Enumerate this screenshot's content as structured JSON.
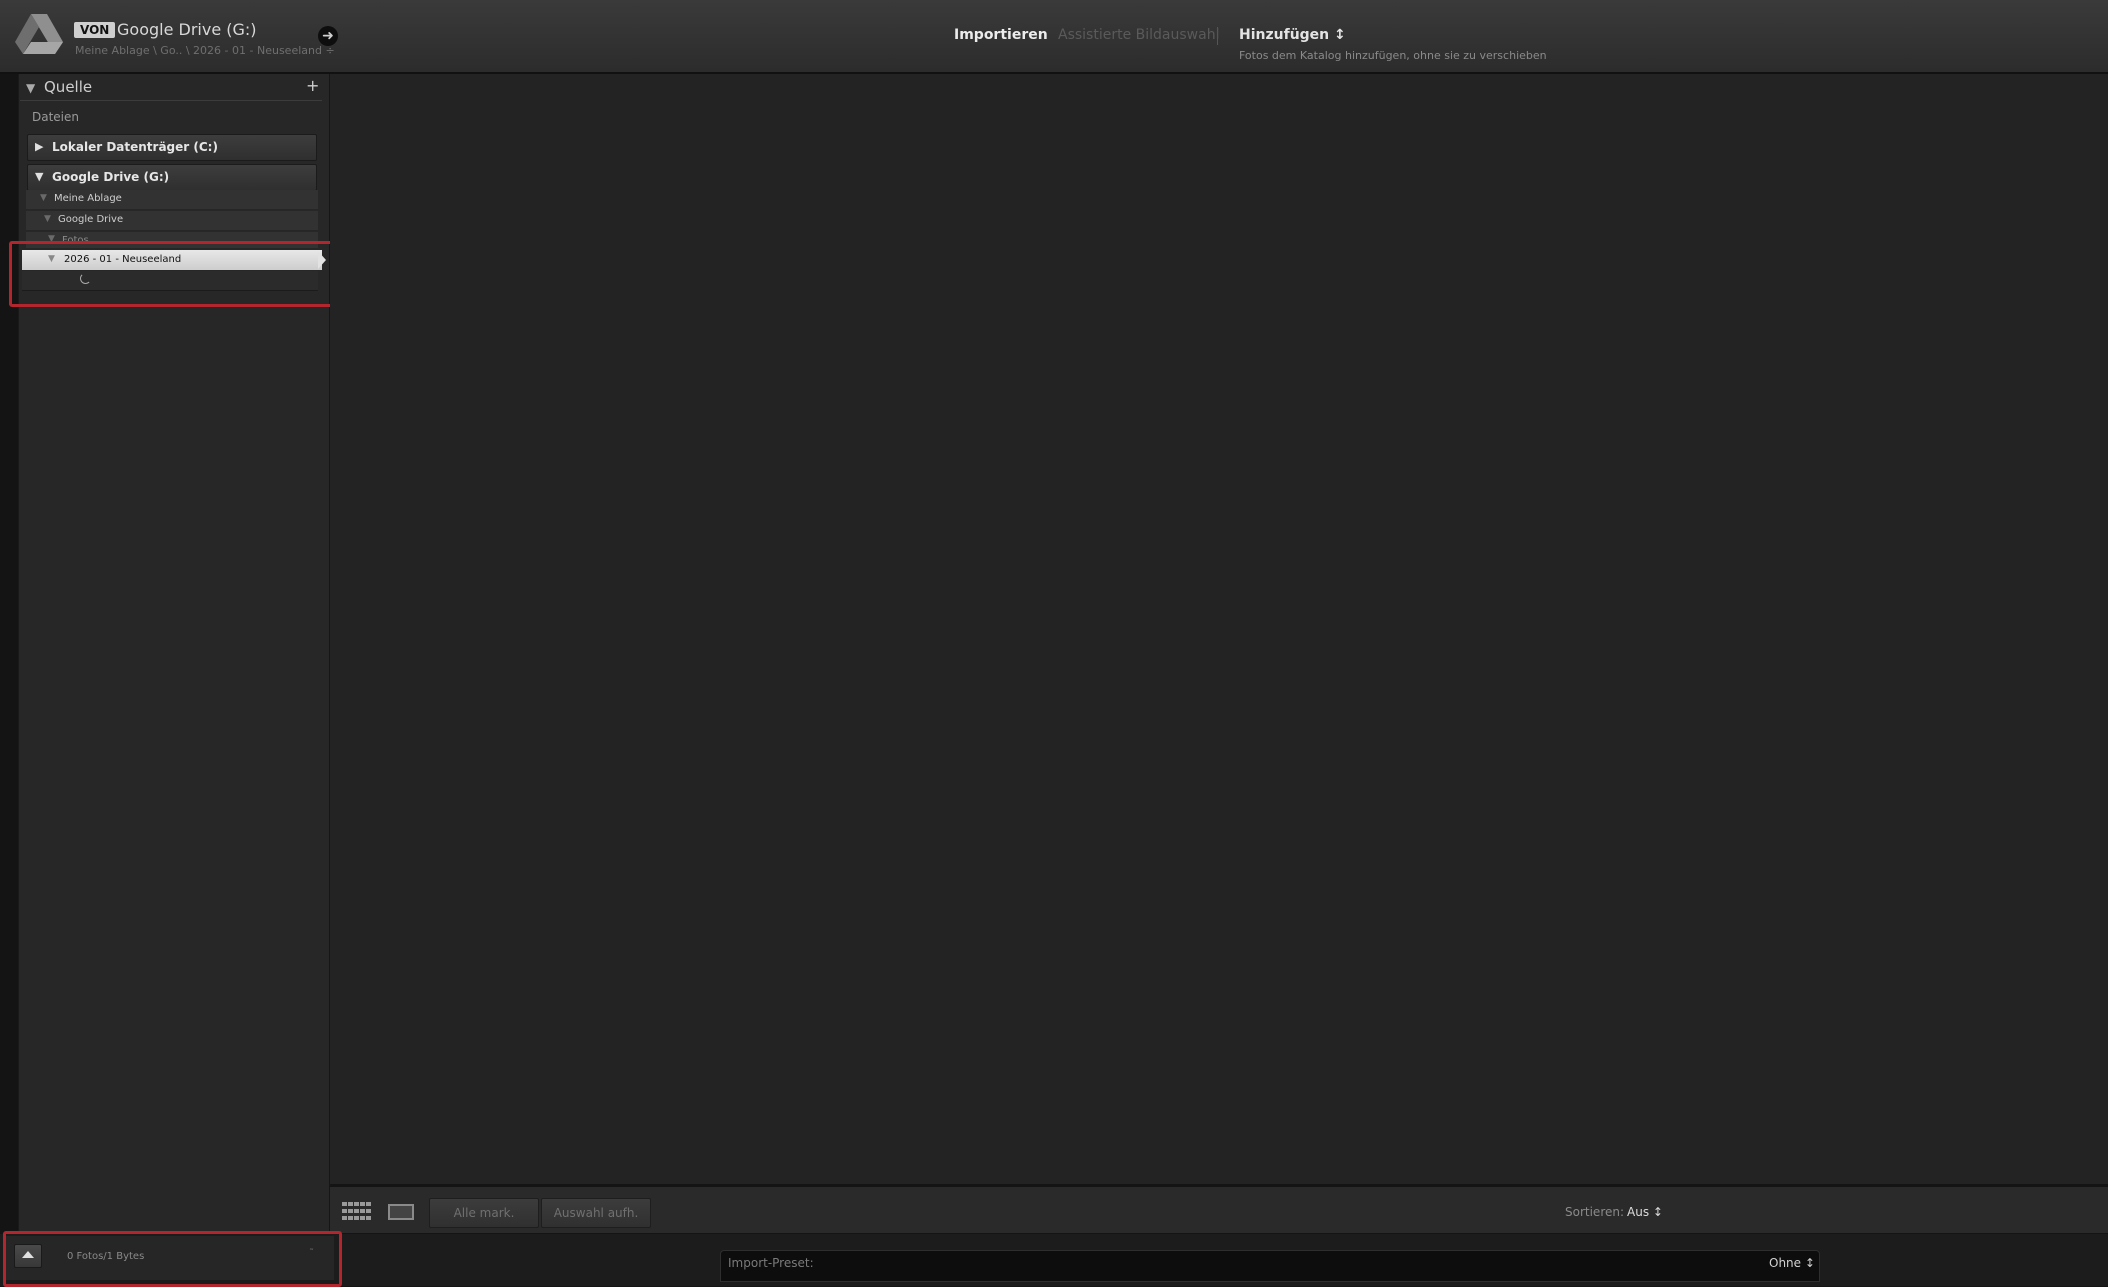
{
  "header": {
    "badge": "VON",
    "source_title": "Google Drive (G:)",
    "source_path": "Meine Ablage \\ Go.. \\ 2026 - 01 - Neuseeland ÷",
    "nav_icon": "arrow-right-icon",
    "modes": {
      "import": "Importieren",
      "assisted": "Assistierte Bildauswahl",
      "add": "Hinzufügen ↕",
      "add_subtitle": "Fotos dem Katalog hinzufügen, ohne sie zu verschieben"
    }
  },
  "source_panel": {
    "title": "Quelle",
    "add_icon": "+",
    "files_label": "Dateien",
    "volumes": [
      {
        "label": "Lokaler Datenträger (C:)",
        "expanded": false
      },
      {
        "label": "Google Drive (G:)",
        "expanded": true
      }
    ],
    "folders": [
      {
        "label": "Meine Ablage"
      },
      {
        "label": "Google Drive"
      },
      {
        "label": "Fotos"
      },
      {
        "label": "2026 - 01 - Neuseeland",
        "selected": true
      }
    ]
  },
  "toolbar": {
    "select_all": "Alle mark.",
    "deselect": "Auswahl aufh.",
    "sort_label": "Sortieren:",
    "sort_value": "Aus ↕"
  },
  "status": {
    "photo_count": "0 Fotos/1 Bytes",
    "status_icon": "˜",
    "preset_label": "Import-Preset:",
    "preset_value": "Ohne ↕"
  },
  "colors": {
    "highlight": "#b3262e",
    "panel": "#272727",
    "main": "#232323"
  }
}
